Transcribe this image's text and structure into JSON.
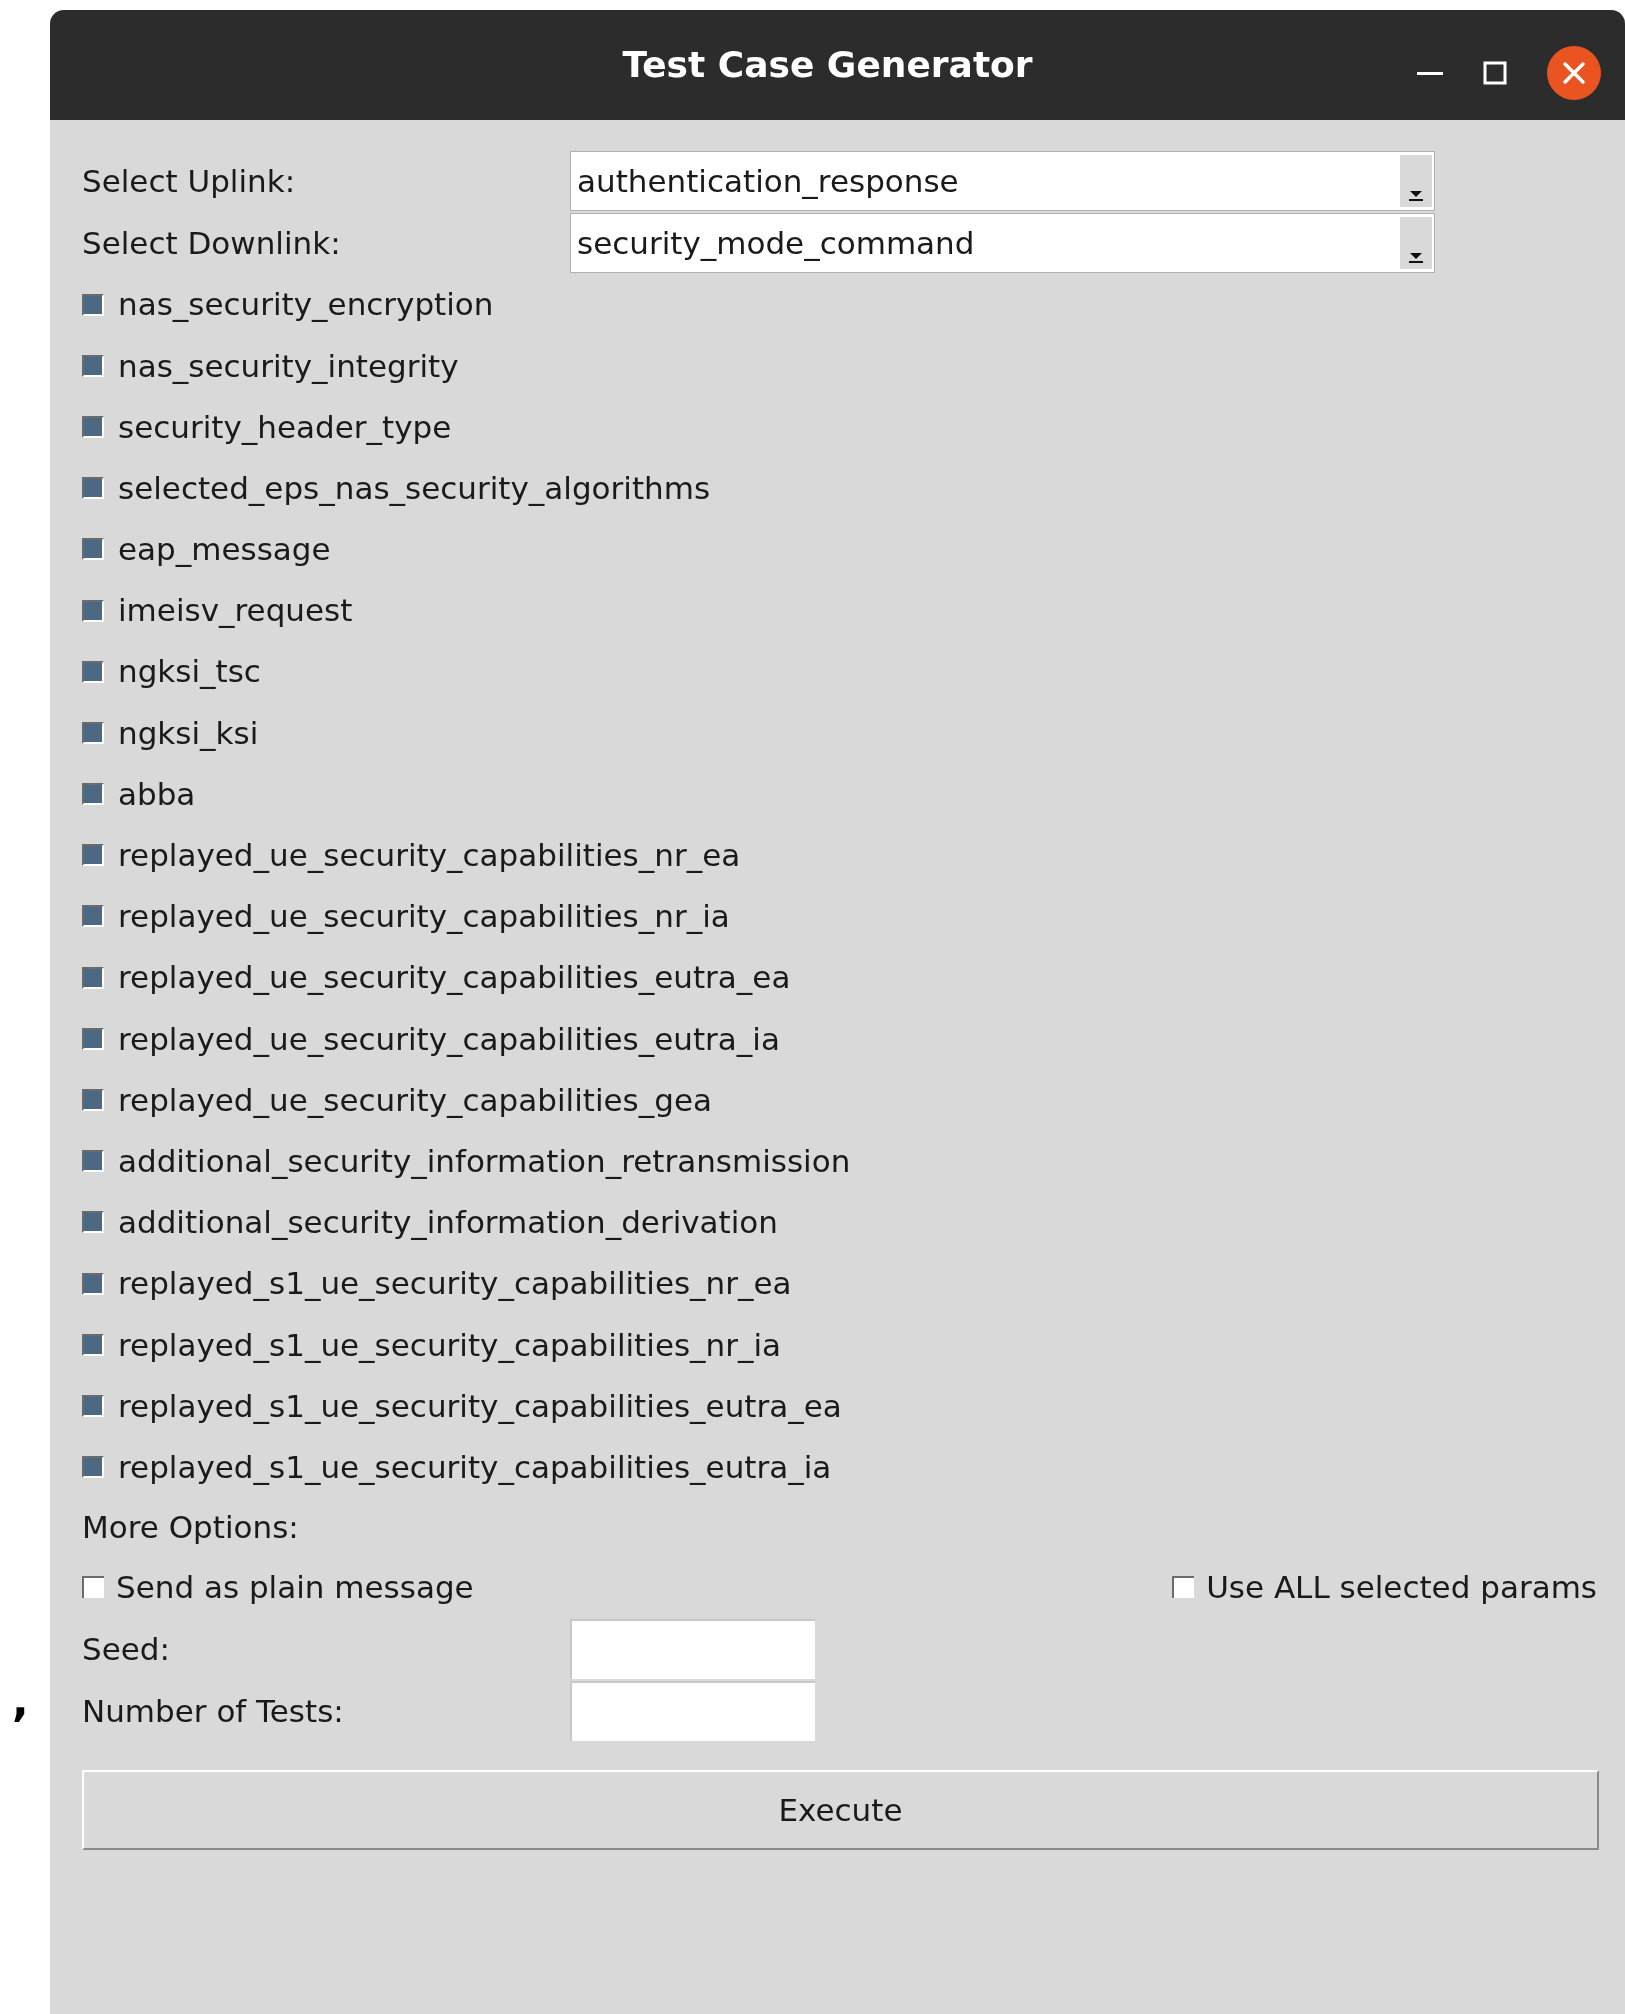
{
  "stray_mark": ",",
  "window": {
    "title": "Test Case Generator"
  },
  "selects": [
    {
      "label": "Select Uplink:",
      "value": "authentication_response"
    },
    {
      "label": "Select Downlink:",
      "value": "security_mode_command"
    }
  ],
  "params": [
    {
      "label": "nas_security_encryption",
      "checked": true
    },
    {
      "label": "nas_security_integrity",
      "checked": true
    },
    {
      "label": "security_header_type",
      "checked": true
    },
    {
      "label": "selected_eps_nas_security_algorithms",
      "checked": true
    },
    {
      "label": "eap_message",
      "checked": true
    },
    {
      "label": "imeisv_request",
      "checked": true
    },
    {
      "label": "ngksi_tsc",
      "checked": true
    },
    {
      "label": "ngksi_ksi",
      "checked": true
    },
    {
      "label": "abba",
      "checked": true
    },
    {
      "label": "replayed_ue_security_capabilities_nr_ea",
      "checked": true
    },
    {
      "label": "replayed_ue_security_capabilities_nr_ia",
      "checked": true
    },
    {
      "label": "replayed_ue_security_capabilities_eutra_ea",
      "checked": true
    },
    {
      "label": "replayed_ue_security_capabilities_eutra_ia",
      "checked": true
    },
    {
      "label": "replayed_ue_security_capabilities_gea",
      "checked": true
    },
    {
      "label": "additional_security_information_retransmission",
      "checked": true
    },
    {
      "label": "additional_security_information_derivation",
      "checked": true
    },
    {
      "label": "replayed_s1_ue_security_capabilities_nr_ea",
      "checked": true
    },
    {
      "label": "replayed_s1_ue_security_capabilities_nr_ia",
      "checked": true
    },
    {
      "label": "replayed_s1_ue_security_capabilities_eutra_ea",
      "checked": true
    },
    {
      "label": "replayed_s1_ue_security_capabilities_eutra_ia",
      "checked": true
    }
  ],
  "more_options": {
    "heading": "More Options:",
    "options": [
      {
        "label": "Send as plain message",
        "checked": false
      },
      {
        "label": "Use ALL selected params",
        "checked": false
      }
    ]
  },
  "fields": [
    {
      "label": "Seed:"
    },
    {
      "label": "Number of Tests:"
    }
  ],
  "execute_button": {
    "label": "Execute"
  }
}
